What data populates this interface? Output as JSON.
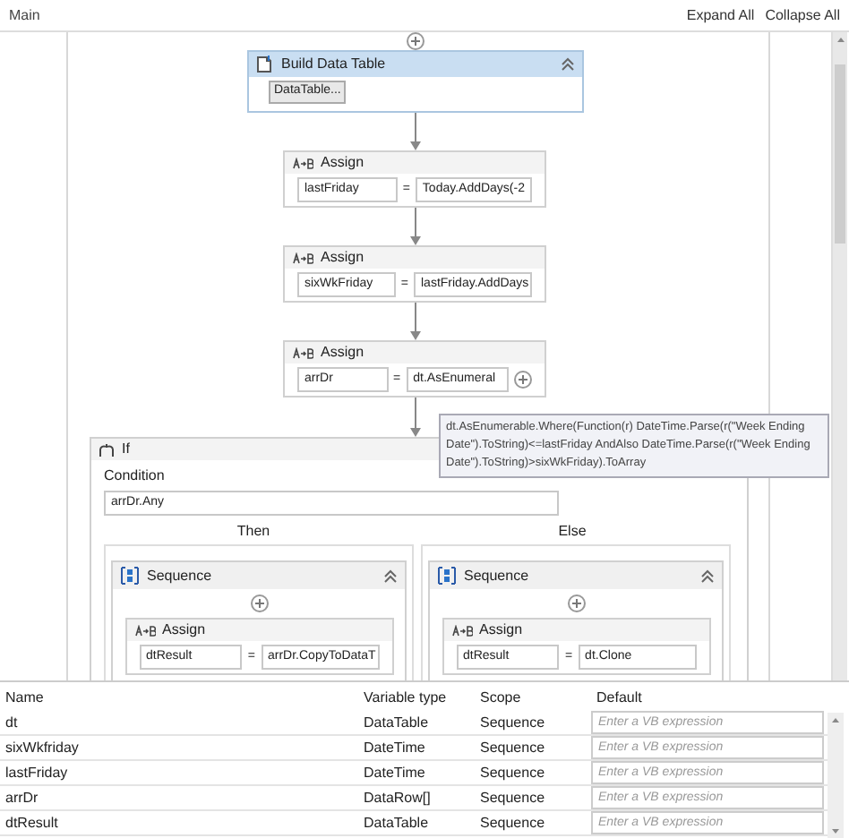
{
  "header": {
    "title": "Main",
    "buttons": [
      "Expand All",
      "Collapse All"
    ]
  },
  "activities": [
    {
      "kind": "build_data_table",
      "title": "Build Data Table",
      "selected": true,
      "button": "DataTable..."
    },
    {
      "kind": "assign",
      "title": "Assign",
      "selected": false,
      "to": "lastFriday",
      "operator": "=",
      "value": "Today.AddDays(-2"
    },
    {
      "kind": "assign",
      "title": "Assign",
      "selected": false,
      "to": "sixWkFriday",
      "operator": "=",
      "value": "lastFriday.AddDays"
    },
    {
      "kind": "assign",
      "title": "Assign",
      "selected": false,
      "to": "arrDr",
      "operator": "=",
      "value": "dt.AsEnumeral",
      "add_button": true
    }
  ],
  "tooltip": "dt.AsEnumerable.Where(Function(r) DateTime.Parse(r(\"Week Ending Date\").ToString)<=lastFriday AndAlso DateTime.Parse(r(\"Week Ending Date\").ToString)>sixWkFriday).ToArray",
  "if_block": {
    "title": "If",
    "condition_label": "Condition",
    "condition": "arrDr.Any",
    "branches": [
      {
        "label": "Then",
        "sequence": "Sequence",
        "assign": {
          "title": "Assign",
          "to": "dtResult",
          "operator": "=",
          "value": "arrDr.CopyToDataT"
        }
      },
      {
        "label": "Else",
        "sequence": "Sequence",
        "assign": {
          "title": "Assign",
          "to": "dtResult",
          "operator": "=",
          "value": "dt.Clone"
        }
      }
    ]
  },
  "variables": {
    "columns": [
      "Name",
      "Variable type",
      "Scope",
      "Default"
    ],
    "rows": [
      {
        "name": "dt",
        "type": "DataTable",
        "scope": "Sequence",
        "default_placeholder": "Enter a VB expression"
      },
      {
        "name": "sixWkfriday",
        "type": "DateTime",
        "scope": "Sequence",
        "default_placeholder": "Enter a VB expression"
      },
      {
        "name": "lastFriday",
        "type": "DateTime",
        "scope": "Sequence",
        "default_placeholder": "Enter a VB expression"
      },
      {
        "name": "arrDr",
        "type": "DataRow[]",
        "scope": "Sequence",
        "default_placeholder": "Enter a VB expression"
      },
      {
        "name": "dtResult",
        "type": "DataTable",
        "scope": "Sequence",
        "default_placeholder": "Enter a VB expression"
      }
    ]
  }
}
